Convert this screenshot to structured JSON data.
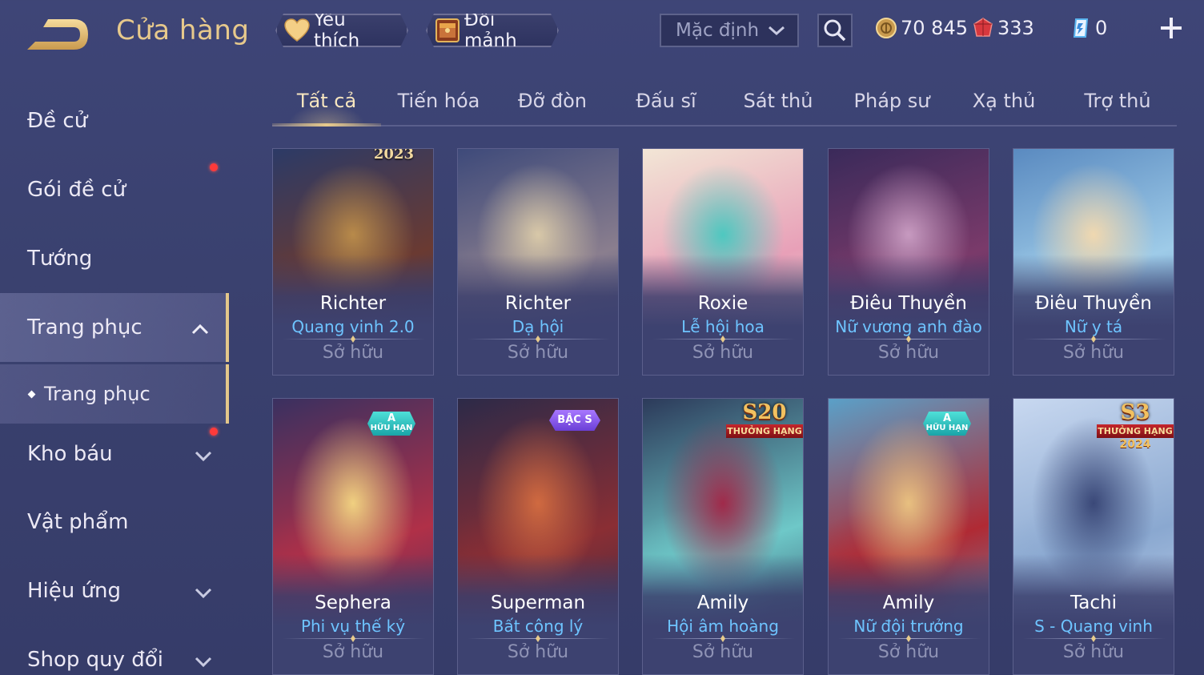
{
  "header": {
    "title": "Cửa hàng",
    "favorites_label": "Yêu thích",
    "exchange_label": "Đổi mảnh",
    "sort_selected": "Mặc định",
    "currencies": [
      {
        "name": "gold",
        "value": "70 845",
        "color": "#e0b25a"
      },
      {
        "name": "voucher",
        "value": "333",
        "color": "#e0464a"
      },
      {
        "name": "crystal",
        "value": "0",
        "color": "#5ab5f0"
      }
    ]
  },
  "sidebar": {
    "items": [
      {
        "label": "Đề cử"
      },
      {
        "label": "Gói đề cử"
      },
      {
        "label": "Tướng"
      },
      {
        "label": "Trang phục"
      },
      {
        "label": "Trang phục"
      },
      {
        "label": "Kho báu"
      },
      {
        "label": "Vật phẩm"
      },
      {
        "label": "Hiệu ứng"
      },
      {
        "label": "Shop quy đổi"
      }
    ]
  },
  "tabs": [
    {
      "label": "Tất cả"
    },
    {
      "label": "Tiến hóa"
    },
    {
      "label": "Đỡ đòn"
    },
    {
      "label": "Đấu sĩ"
    },
    {
      "label": "Sát thủ"
    },
    {
      "label": "Pháp sư"
    },
    {
      "label": "Xạ thủ"
    },
    {
      "label": "Trợ thủ"
    }
  ],
  "cards": [
    {
      "hero": "Richter",
      "skin": "Quang vinh 2.0",
      "status": "Sở hữu",
      "badge_text": "2023",
      "colors": [
        "#6a3a32",
        "#b88a4a",
        "#2c3a66"
      ]
    },
    {
      "hero": "Richter",
      "skin": "Dạ hội",
      "status": "Sở hữu",
      "colors": [
        "#8a7e8e",
        "#d8c8a8",
        "#3e4a7a"
      ]
    },
    {
      "hero": "Roxie",
      "skin": "Lễ hội hoa",
      "status": "Sở hữu",
      "colors": [
        "#e8a0b8",
        "#4ec8c0",
        "#f2e6d6"
      ]
    },
    {
      "hero": "Điêu Thuyền",
      "skin": "Nữ vương anh đào",
      "status": "Sở hữu",
      "colors": [
        "#7a3a6a",
        "#c79ac0",
        "#3a2a5a"
      ]
    },
    {
      "hero": "Điêu Thuyền",
      "skin": "Nữ y tá",
      "status": "Sở hữu",
      "colors": [
        "#9ecbe8",
        "#f0d8b0",
        "#5a8ac0"
      ]
    },
    {
      "hero": "Sephera",
      "skin": "Phi vụ thế kỷ",
      "status": "Sở hữu",
      "badge": "A",
      "badge_sub": "HỮU HẠN",
      "colors": [
        "#b03048",
        "#f0d080",
        "#3a3060"
      ]
    },
    {
      "hero": "Superman",
      "skin": "Bất công lý",
      "status": "Sở hữu",
      "badge": "BẬC S",
      "colors": [
        "#8a2e34",
        "#d06a40",
        "#2c2a48"
      ]
    },
    {
      "hero": "Amily",
      "skin": "Hội âm hoàng",
      "status": "Sở hữu",
      "badge": "S20",
      "badge_sub": "THƯỞNG HẠNG",
      "colors": [
        "#6ec8c8",
        "#a02a4a",
        "#2c3a5a"
      ]
    },
    {
      "hero": "Amily",
      "skin": "Nữ đội trưởng",
      "status": "Sở hữu",
      "badge": "A",
      "badge_sub": "HỮU HẠN",
      "colors": [
        "#b02a34",
        "#e8c080",
        "#5aa0c8"
      ]
    },
    {
      "hero": "Tachi",
      "skin": "S - Quang vinh",
      "status": "Sở hữu",
      "badge": "S3",
      "badge_sub": "THƯỞNG HẠNG",
      "badge_year": "2024",
      "colors": [
        "#8aa8d0",
        "#3a4878",
        "#c8d8f0"
      ]
    }
  ]
}
